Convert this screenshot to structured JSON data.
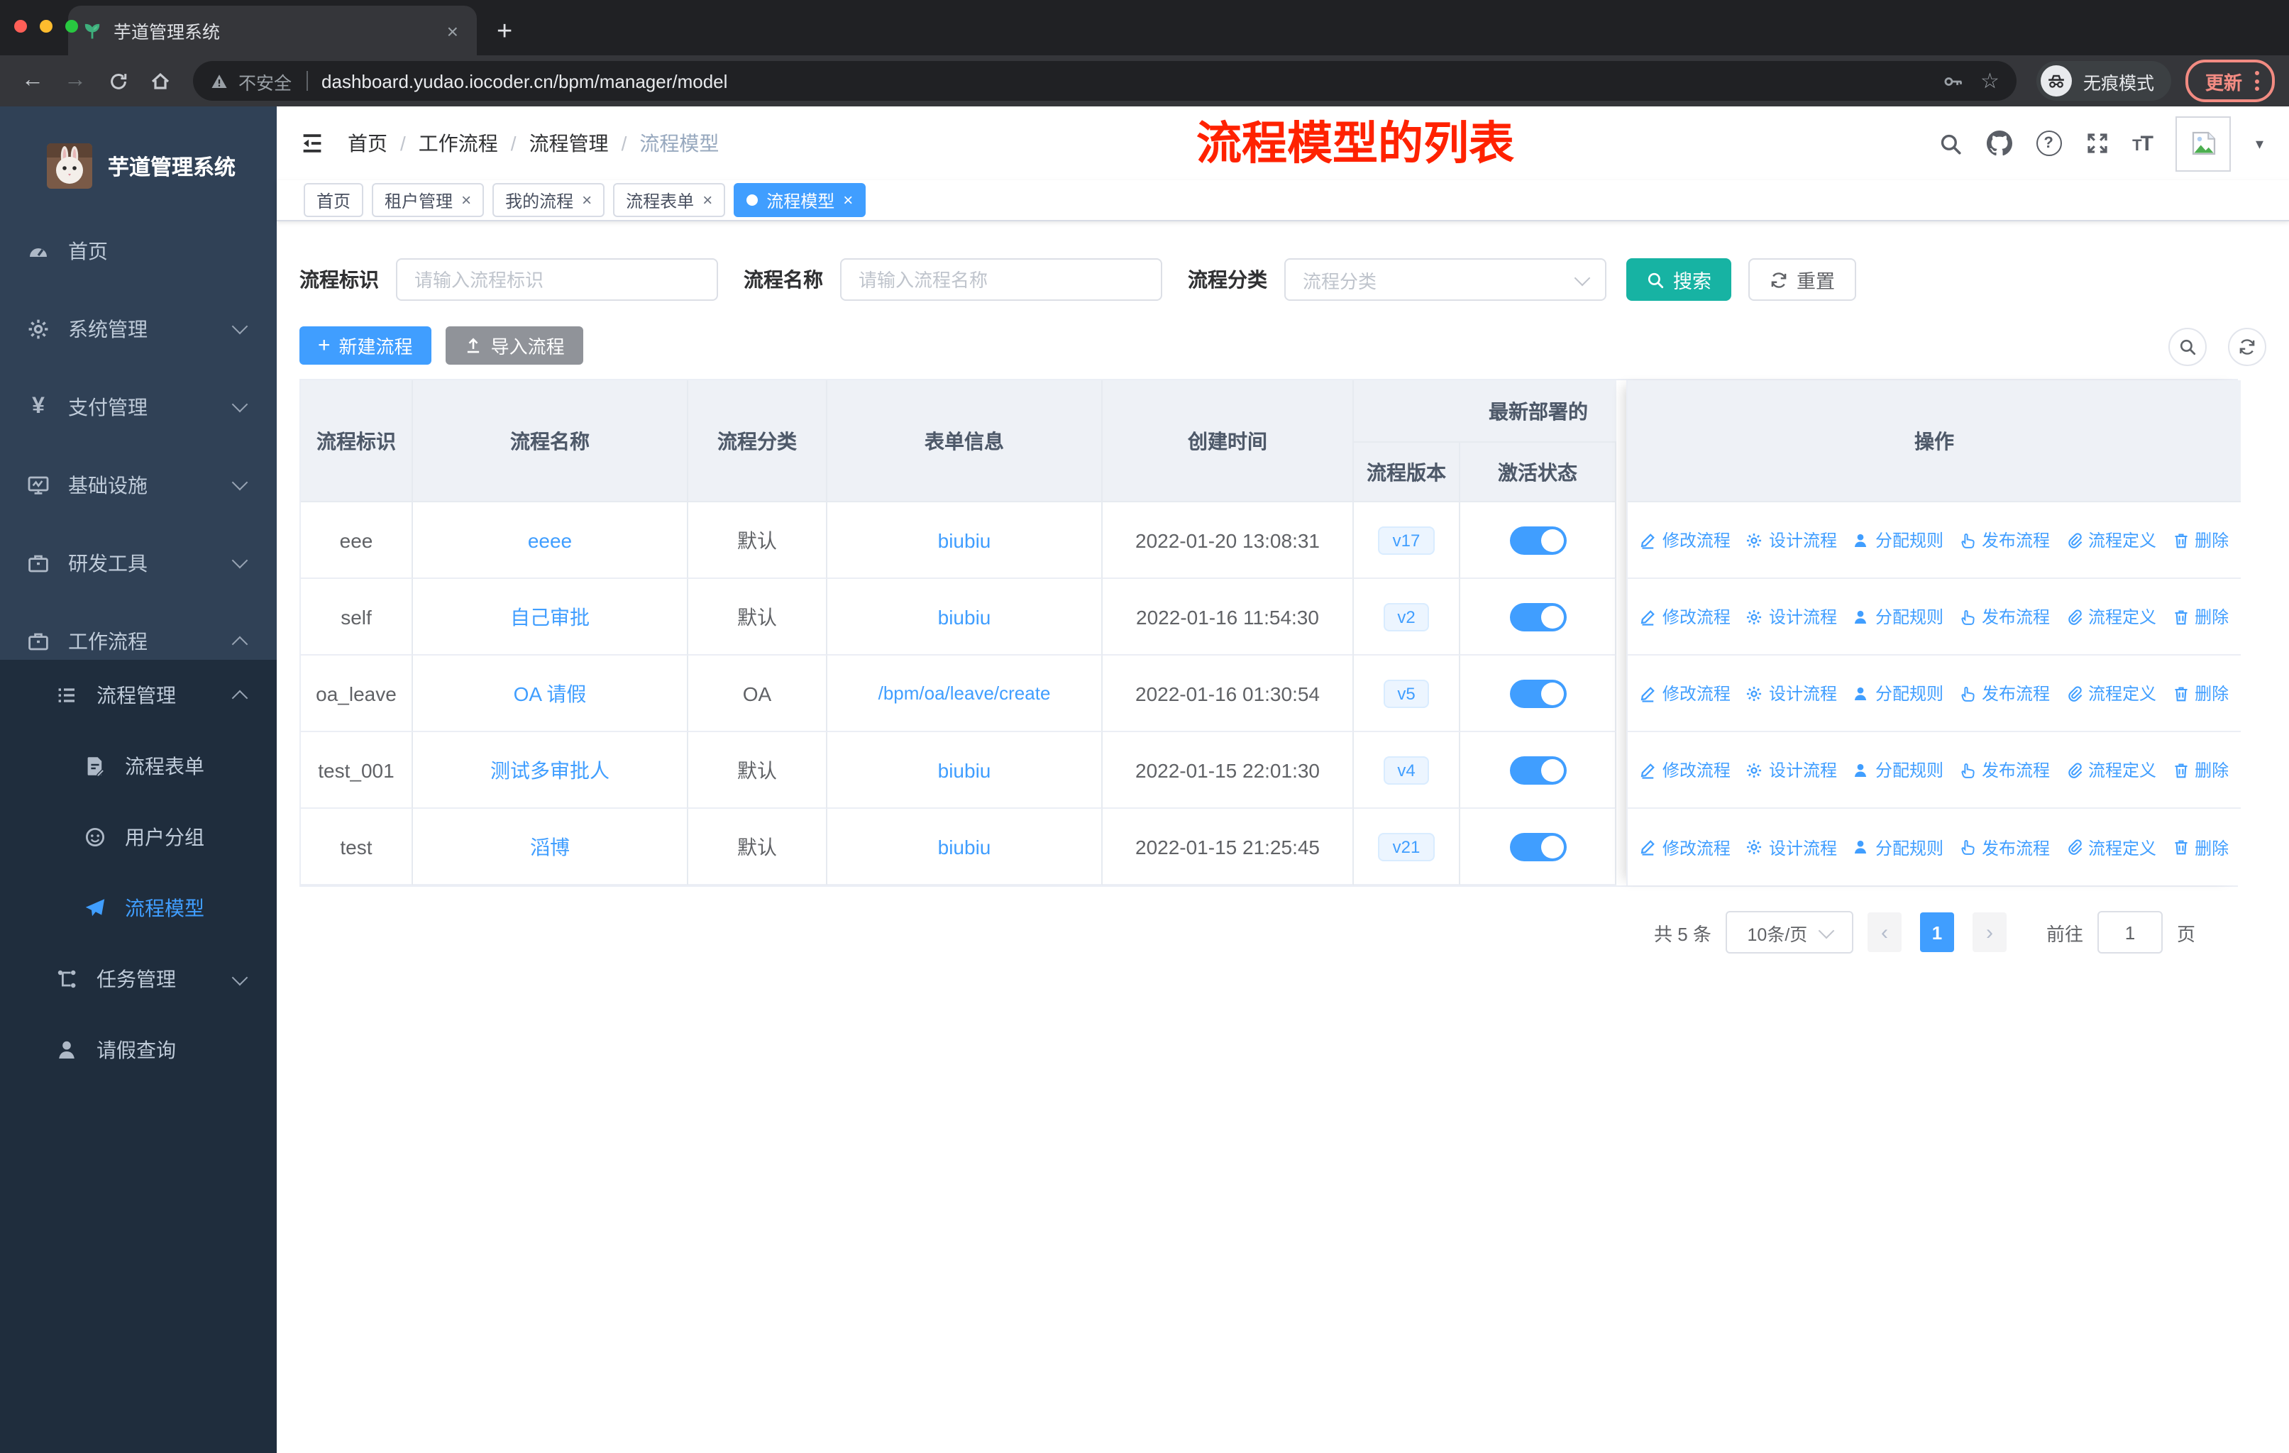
{
  "browser": {
    "tab_title": "芋道管理系统",
    "close_glyph": "×",
    "new_tab_glyph": "+",
    "back_glyph": "←",
    "forward_glyph": "→",
    "security_label": "不安全",
    "url": "dashboard.yudao.iocoder.cn/bpm/manager/model",
    "star_glyph": "☆",
    "incognito_label": "无痕模式",
    "update_label": "更新"
  },
  "annotation": {
    "text": "流程模型的列表",
    "color": "#ff2200"
  },
  "sidebar": {
    "title": "芋道管理系统",
    "items": [
      {
        "label": "首页"
      },
      {
        "label": "系统管理"
      },
      {
        "label": "支付管理"
      },
      {
        "label": "基础设施"
      },
      {
        "label": "研发工具"
      },
      {
        "label": "工作流程"
      }
    ],
    "submenu": [
      {
        "label": "流程管理"
      },
      {
        "label": "流程表单"
      },
      {
        "label": "用户分组"
      },
      {
        "label": "流程模型"
      },
      {
        "label": "任务管理"
      },
      {
        "label": "请假查询"
      }
    ]
  },
  "navbar": {
    "breadcrumb": [
      "首页",
      "工作流程",
      "流程管理",
      "流程模型"
    ],
    "separator": "/",
    "font_size_glyph": "T"
  },
  "tags": [
    {
      "label": "首页"
    },
    {
      "label": "租户管理"
    },
    {
      "label": "我的流程"
    },
    {
      "label": "流程表单"
    },
    {
      "label": "流程模型"
    }
  ],
  "filters": {
    "id_label": "流程标识",
    "id_placeholder": "请输入流程标识",
    "name_label": "流程名称",
    "name_placeholder": "请输入流程名称",
    "category_label": "流程分类",
    "category_placeholder": "流程分类",
    "search_label": "搜索",
    "reset_label": "重置"
  },
  "toolbar": {
    "create_label": "新建流程",
    "import_label": "导入流程"
  },
  "table": {
    "col_id": "流程标识",
    "col_name": "流程名称",
    "col_category": "流程分类",
    "col_form": "表单信息",
    "col_created": "创建时间",
    "group_header": "最新部署的",
    "col_version": "流程版本",
    "col_active": "激活状态",
    "col_actions": "操作",
    "actions": [
      "修改流程",
      "设计流程",
      "分配规则",
      "发布流程",
      "流程定义",
      "删除"
    ],
    "rows": [
      {
        "id": "eee",
        "name": "eeee",
        "category": "默认",
        "form": "biubiu",
        "created": "2022-01-20 13:08:31",
        "version": "v17"
      },
      {
        "id": "self",
        "name": "自己审批",
        "category": "默认",
        "form": "biubiu",
        "created": "2022-01-16 11:54:30",
        "version": "v2"
      },
      {
        "id": "oa_leave",
        "name": "OA 请假",
        "category": "OA",
        "form": "/bpm/oa/leave/create",
        "created": "2022-01-16 01:30:54",
        "version": "v5"
      },
      {
        "id": "test_001",
        "name": "测试多审批人",
        "category": "默认",
        "form": "biubiu",
        "created": "2022-01-15 22:01:30",
        "version": "v4"
      },
      {
        "id": "test",
        "name": "滔博",
        "category": "默认",
        "form": "biubiu",
        "created": "2022-01-15 21:25:45",
        "version": "v21"
      }
    ]
  },
  "pagination": {
    "total": "共 5 条",
    "page_size": "10条/页",
    "prev": "‹",
    "next": "›",
    "page": "1",
    "goto_label": "前往",
    "goto_value": "1",
    "unit": "页"
  },
  "colors": {
    "primary": "#409eff",
    "search_teal": "#17b3a3",
    "sidebar_bg": "#304156",
    "submenu_bg": "#1f2d3d"
  }
}
